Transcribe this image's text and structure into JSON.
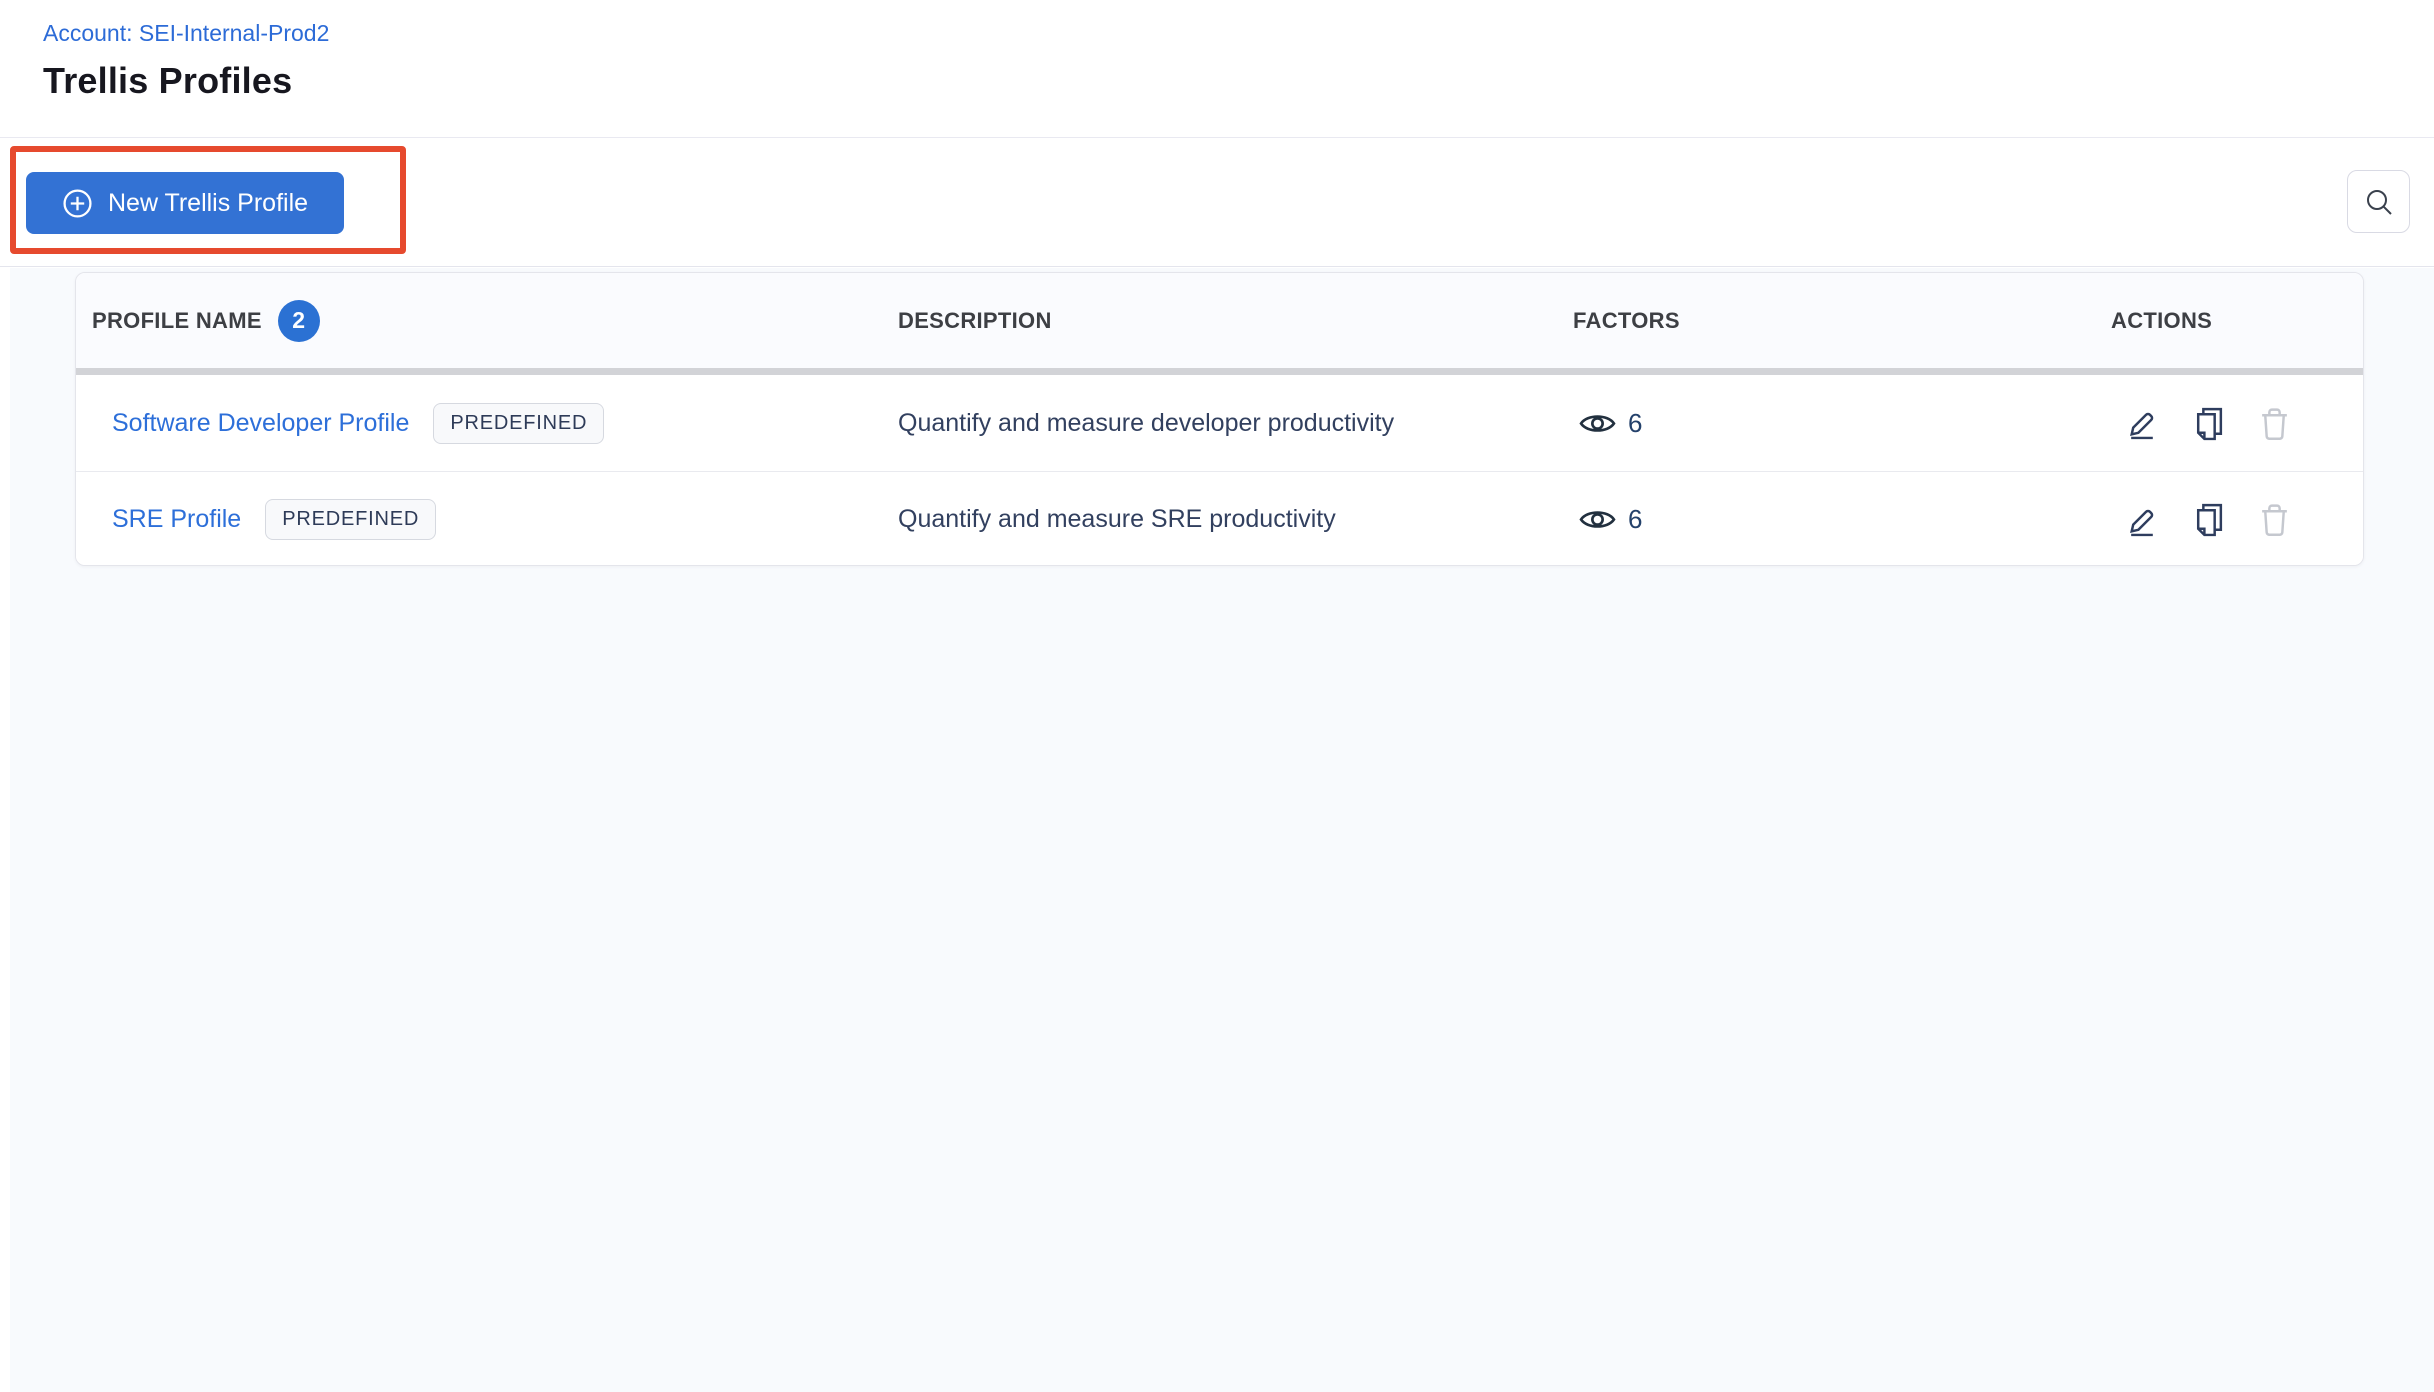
{
  "page": {
    "breadcrumb": "Account: SEI-Internal-Prod2",
    "title": "Trellis Profiles"
  },
  "toolbar": {
    "new_profile_button_label": "New Trellis Profile",
    "icons": {
      "plus_circle": "plus-circle-icon",
      "search": "search-icon"
    }
  },
  "annotation": {
    "shape": "red-rectangle-highlight",
    "target": "new-trellis-profile-button",
    "color": "#e64a2e"
  },
  "table": {
    "columns": [
      "PROFILE NAME",
      "DESCRIPTION",
      "FACTORS",
      "ACTIONS"
    ],
    "profile_count": "2",
    "rows": [
      {
        "name": "Software Developer Profile",
        "tag": "PREDEFINED",
        "description": "Quantify and measure developer productivity",
        "factors": "6"
      },
      {
        "name": "SRE Profile",
        "tag": "PREDEFINED",
        "description": "Quantify and measure SRE productivity",
        "factors": "6"
      }
    ],
    "row_icons": [
      "eye-icon",
      "edit-pencil-icon",
      "copy-icon",
      "trash-icon"
    ]
  },
  "colors": {
    "primary_button_blue": "#3372d4",
    "link_blue": "#2d6fd9",
    "count_badge_blue": "#2b71d3",
    "annotation_red": "#e64a2e",
    "title_text": "#17171f",
    "header_text": "#3d3f44",
    "body_text_navy": "#32405f",
    "disabled_icon_gray": "#c5c8cf",
    "content_background": "#f8fafd",
    "thick_divider": "#d2d3d7"
  }
}
